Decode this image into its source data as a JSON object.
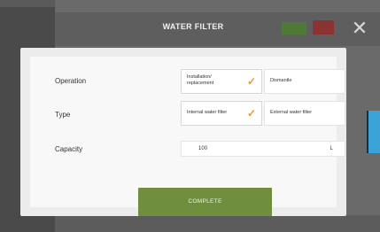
{
  "header": {
    "title": "WATER FILTER",
    "close_symbol": "✕"
  },
  "form": {
    "operation": {
      "label": "Operation",
      "options": [
        {
          "label": "Installation/ replacement",
          "selected": true
        },
        {
          "label": "Dismantle",
          "selected": false
        }
      ]
    },
    "type": {
      "label": "Type",
      "options": [
        {
          "label": "Internal water filter",
          "selected": true
        },
        {
          "label": "External water filter",
          "selected": false
        }
      ]
    },
    "capacity": {
      "label": "Capacity",
      "value": "100",
      "unit": "L"
    },
    "check_symbol": "✓"
  },
  "actions": {
    "complete_label": "COMPLETE"
  },
  "colors": {
    "accent_green": "#6f8f3e",
    "check_orange": "#e89a2a",
    "header_red": "#8b3232",
    "side_blue": "#3aa4d8"
  }
}
